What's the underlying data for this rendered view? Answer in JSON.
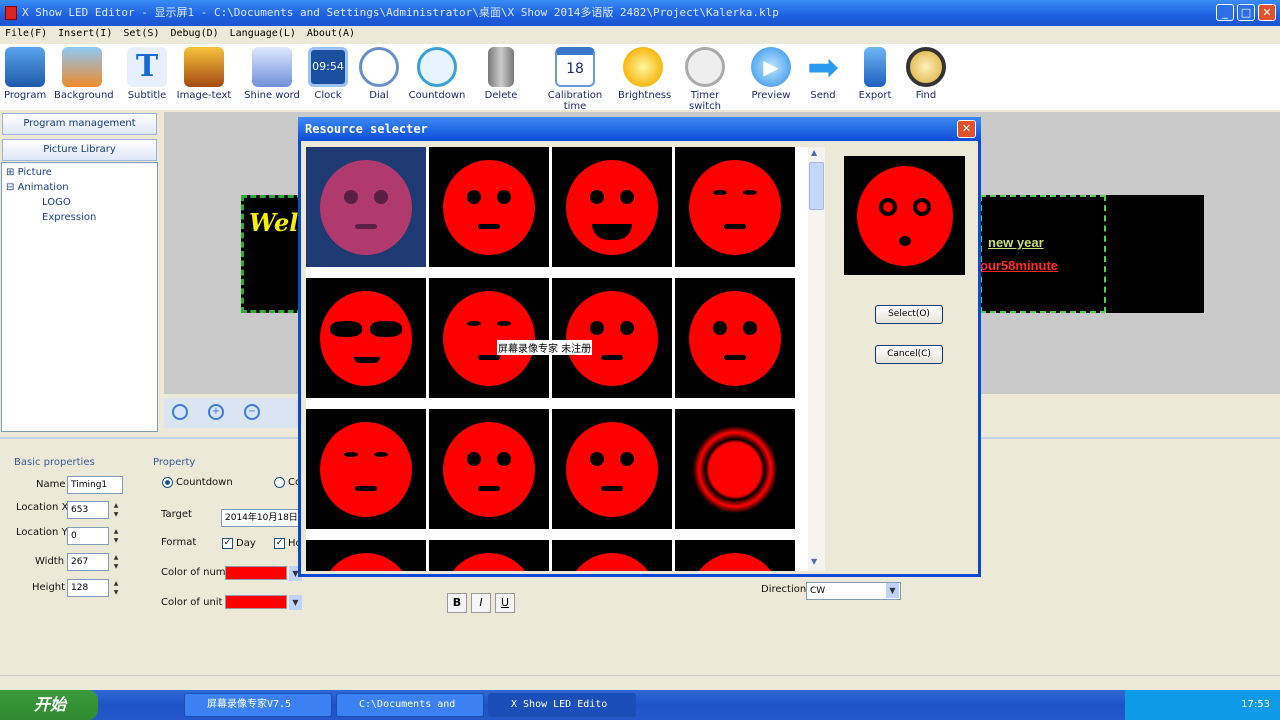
{
  "window": {
    "title": "X Show LED Editor - 显示屏1 - C:\\Documents and Settings\\Administrator\\桌面\\X Show 2014多语版 2482\\Project\\Kalerka.klp"
  },
  "menu": [
    "File(F)",
    "Insert(I)",
    "Set(S)",
    "Debug(D)",
    "Language(L)",
    "About(A)"
  ],
  "toolbar": [
    {
      "label": "Program",
      "icon": "program-icon"
    },
    {
      "label": "Background",
      "icon": "background-icon"
    },
    {
      "label": "Subtitle",
      "icon": "subtitle-icon"
    },
    {
      "label": "Image-text",
      "icon": "image-text-icon"
    },
    {
      "label": "Shine word",
      "icon": "shine-word-icon"
    },
    {
      "label": "Clock",
      "icon": "clock-icon",
      "extra": "09:54"
    },
    {
      "label": "Dial",
      "icon": "dial-icon"
    },
    {
      "label": "Countdown",
      "icon": "countdown-icon"
    },
    {
      "label": "Delete",
      "icon": "delete-icon"
    },
    {
      "label": "Calibration time",
      "icon": "calendar-icon",
      "extra": "18"
    },
    {
      "label": "Brightness",
      "icon": "brightness-icon"
    },
    {
      "label": "Timer switch",
      "icon": "timer-switch-icon"
    },
    {
      "label": "Preview",
      "icon": "preview-icon"
    },
    {
      "label": "Send",
      "icon": "send-icon"
    },
    {
      "label": "Export",
      "icon": "export-icon"
    },
    {
      "label": "Find",
      "icon": "find-icon"
    }
  ],
  "left": {
    "program_management": "Program management",
    "picture_library": "Picture Library",
    "tree": [
      "Picture",
      "Animation",
      "LOGO",
      "Expression"
    ]
  },
  "canvas": {
    "led_text1": "Wel",
    "led_text2": "new year",
    "led_text3": "our58minute"
  },
  "props": {
    "basic_header": "Basic properties",
    "property_header": "Property",
    "name_label": "Name",
    "name_value": "Timing1",
    "locx_label": "Location X",
    "locx_value": "653",
    "locy_label": "Location Y",
    "locy_value": "0",
    "width_label": "Width",
    "width_value": "267",
    "height_label": "Height",
    "height_value": "128",
    "countdown_label": "Countdown",
    "co_label": "Co",
    "target_label": "Target",
    "target_value": "2014年10月18日",
    "format_label": "Format",
    "day_label": "Day",
    "ho_label": "Ho",
    "color_num_label": "Color of numb",
    "color_unit_label": "Color of unit",
    "direction_label": "Direction",
    "direction_value": "CW",
    "bold": "B",
    "italic": "I",
    "underline": "U",
    "color_red": "#ff0000"
  },
  "dialog": {
    "title": "Resource selecter",
    "select_label": "Select(O)",
    "cancel_label": "Cancel(C)",
    "watermark": "屏幕录像专家 未注册"
  },
  "taskbar": {
    "start": "开始",
    "tasks": [
      "屏幕录像专家V7.5",
      "C:\\Documents and",
      "X Show LED Edito"
    ],
    "time": "17:53"
  }
}
